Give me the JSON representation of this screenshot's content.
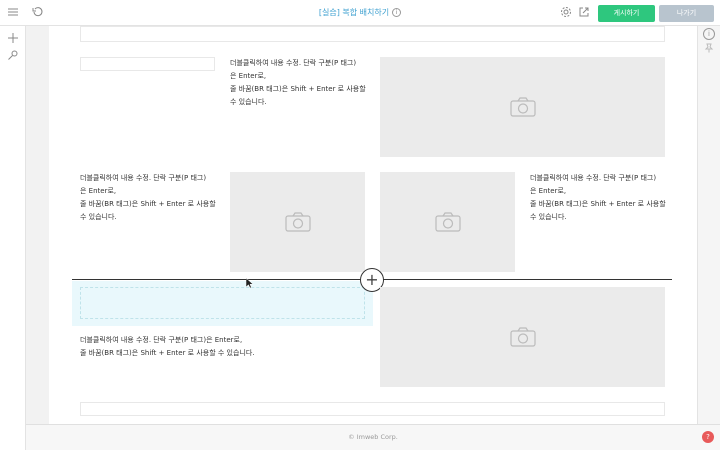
{
  "topbar": {
    "title": "[실습] 복합 배치하기",
    "publish_label": "게시하기",
    "exit_label": "나가기",
    "icons": [
      "menu-icon",
      "history-icon",
      "info-icon",
      "settings-icon",
      "external-link-icon"
    ]
  },
  "leftbar": {
    "icons": [
      "add-icon",
      "pin-icon"
    ]
  },
  "rightbar": {
    "icons": [
      "info-icon",
      "pin-icon"
    ]
  },
  "canvas": {
    "text_block_1": {
      "line1": "더블클릭하여 내용 수정. 단락 구분(P 태그)",
      "line2": "은 Enter로,",
      "line3": "줄 바꿈(BR 태그)은 Shift + Enter 로 사용할",
      "line4": "수 있습니다."
    },
    "text_block_2": {
      "line1": "더블클릭하여 내용 수정. 단락 구분(P 태그)",
      "line2": "은 Enter로,",
      "line3": "줄 바꿈(BR 태그)은 Shift + Enter 로 사용할",
      "line4": "수 있습니다."
    },
    "text_block_3": {
      "line1": "더블클릭하여 내용 수정. 단락 구분(P 태그)",
      "line2": "은 Enter로,",
      "line3": "줄 바꿈(BR 태그)은 Shift + Enter 로 사용할",
      "line4": "수 있습니다."
    },
    "text_block_4": {
      "line1": "더블클릭하여 내용 수정. 단락 구분(P 태그)은 Enter로,",
      "line2": "줄 바꿈(BR 태그)은 Shift + Enter 로 사용할 수 있습니다."
    },
    "add_section_symbol": "+"
  },
  "footer": {
    "copyright": "© Imweb Corp."
  },
  "help": {
    "label": "?"
  },
  "colors": {
    "accent_green": "#2ec77e",
    "title_blue": "#3ea0d0",
    "highlight": "#e9f8fc"
  }
}
